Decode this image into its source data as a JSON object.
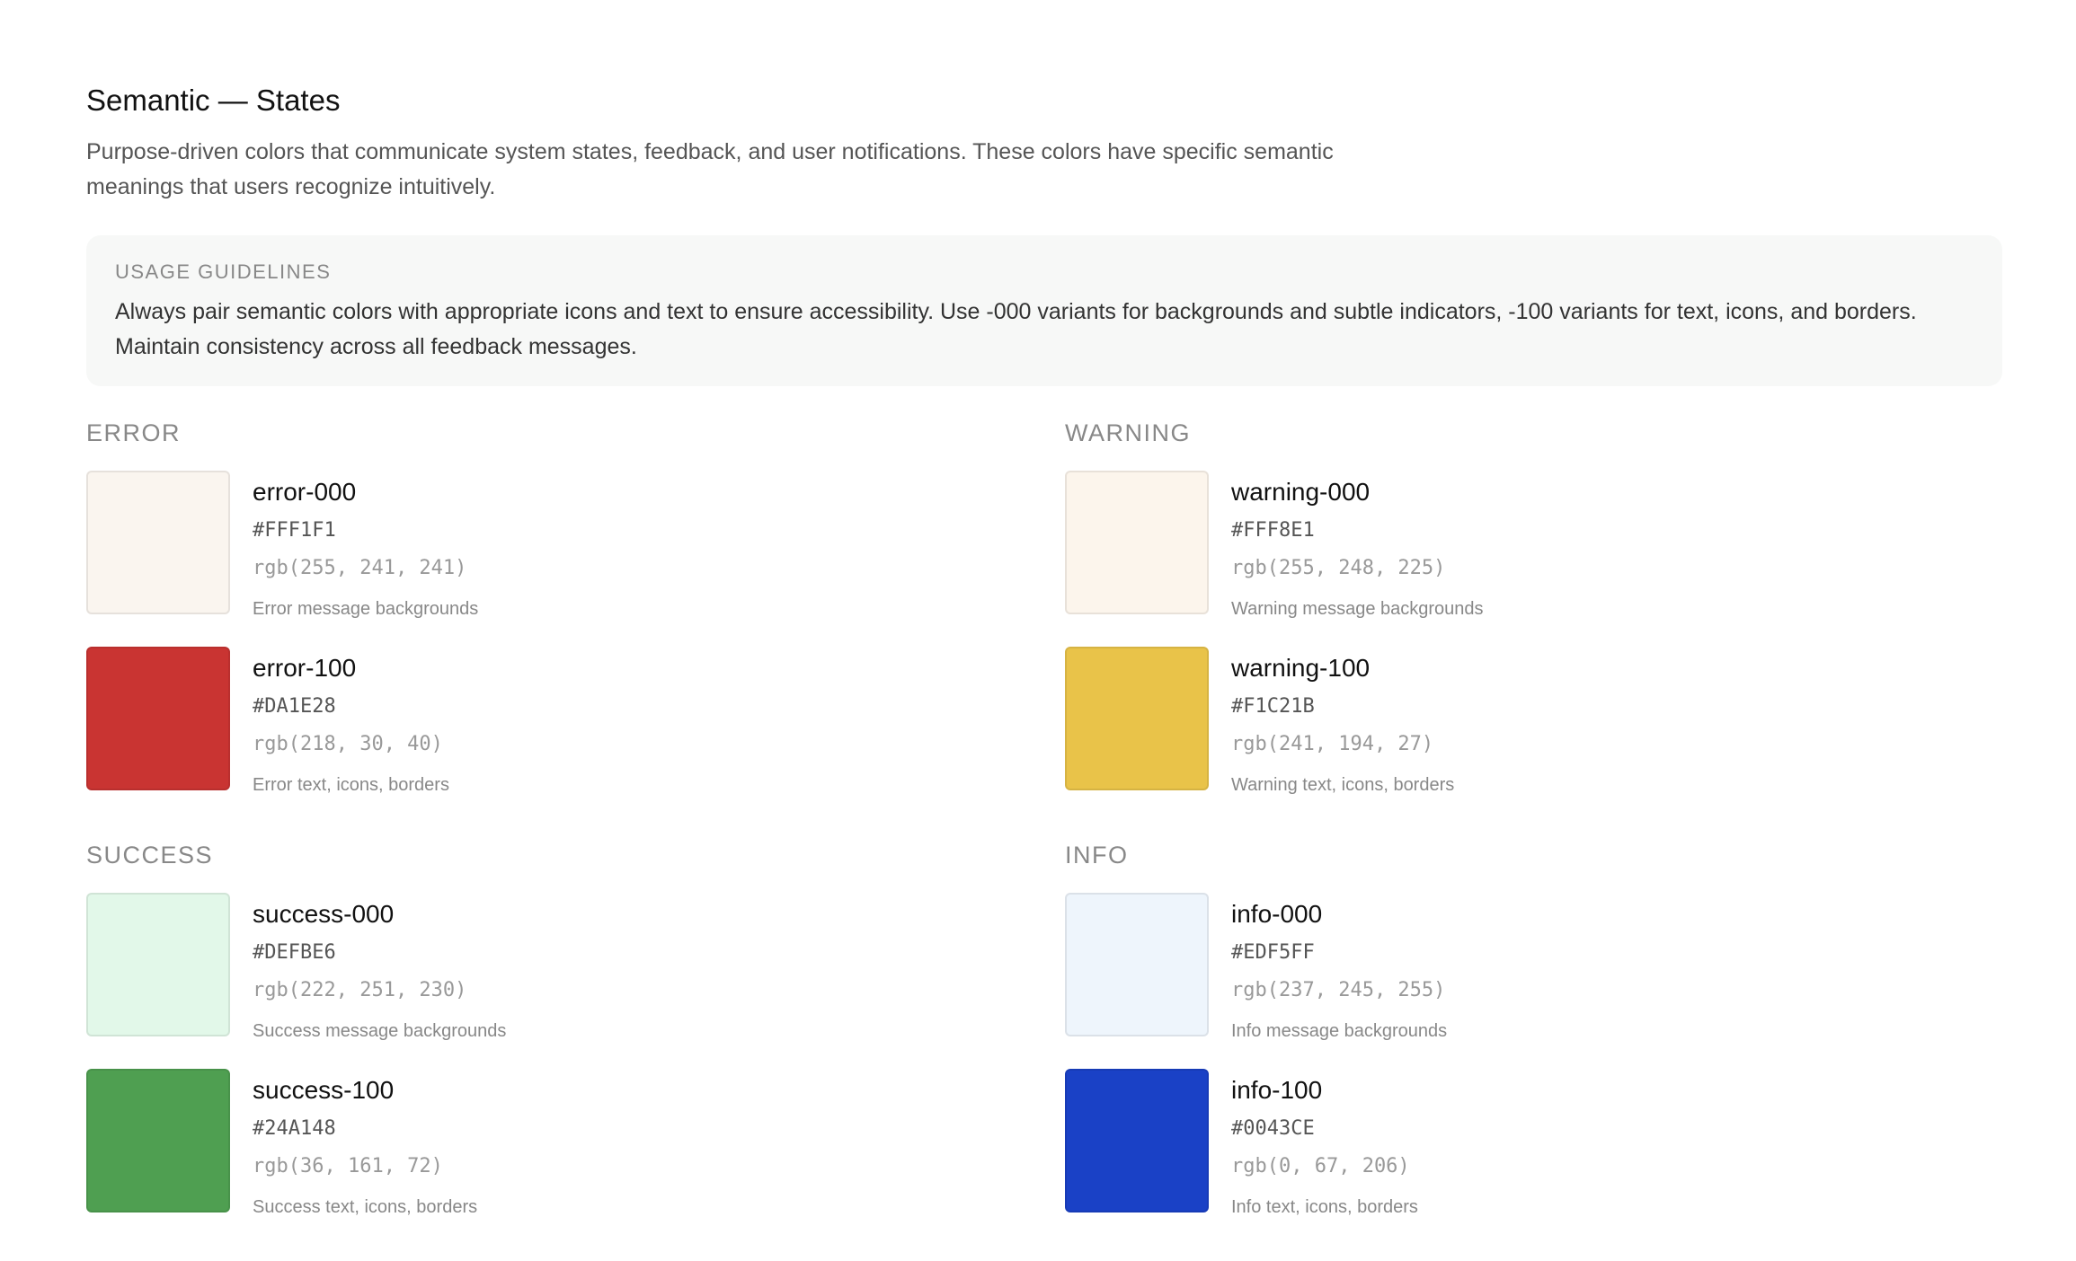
{
  "page": {
    "title": "Semantic — States",
    "description": "Purpose-driven colors that communicate system states, feedback, and user notifications. These colors have specific semantic meanings that users recognize intuitively."
  },
  "guidelines": {
    "label": "USAGE GUIDELINES",
    "text": "Always pair semantic colors with appropriate icons and text to ensure accessibility. Use -000 variants for backgrounds and subtle indicators, -100 variants for text, icons, and borders. Maintain consistency across all feedback messages."
  },
  "groups": {
    "error": {
      "label": "ERROR",
      "colors": [
        {
          "name": "error-000",
          "hex": "#FFF1F1",
          "rgb": "rgb(255, 241, 241)",
          "usage": "Error message backgrounds",
          "swatch": "#FAF5EF"
        },
        {
          "name": "error-100",
          "hex": "#DA1E28",
          "rgb": "rgb(218, 30, 40)",
          "usage": "Error text, icons, borders",
          "swatch": "#C93432"
        }
      ]
    },
    "warning": {
      "label": "WARNING",
      "colors": [
        {
          "name": "warning-000",
          "hex": "#FFF8E1",
          "rgb": "rgb(255, 248, 225)",
          "usage": "Warning message backgrounds",
          "swatch": "#FCF5EC"
        },
        {
          "name": "warning-100",
          "hex": "#F1C21B",
          "rgb": "rgb(241, 194, 27)",
          "usage": "Warning text, icons, borders",
          "swatch": "#E9C349"
        }
      ]
    },
    "success": {
      "label": "SUCCESS",
      "colors": [
        {
          "name": "success-000",
          "hex": "#DEFBE6",
          "rgb": "rgb(222, 251, 230)",
          "usage": "Success message backgrounds",
          "swatch": "#E2F8E9"
        },
        {
          "name": "success-100",
          "hex": "#24A148",
          "rgb": "rgb(36, 161, 72)",
          "usage": "Success text, icons, borders",
          "swatch": "#4F9F51"
        }
      ]
    },
    "info": {
      "label": "INFO",
      "colors": [
        {
          "name": "info-000",
          "hex": "#EDF5FF",
          "rgb": "rgb(237, 245, 255)",
          "usage": "Info message backgrounds",
          "swatch": "#EEF5FC"
        },
        {
          "name": "info-100",
          "hex": "#0043CE",
          "rgb": "rgb(0, 67, 206)",
          "usage": "Info text, icons, borders",
          "swatch": "#1A41C6"
        }
      ]
    }
  }
}
